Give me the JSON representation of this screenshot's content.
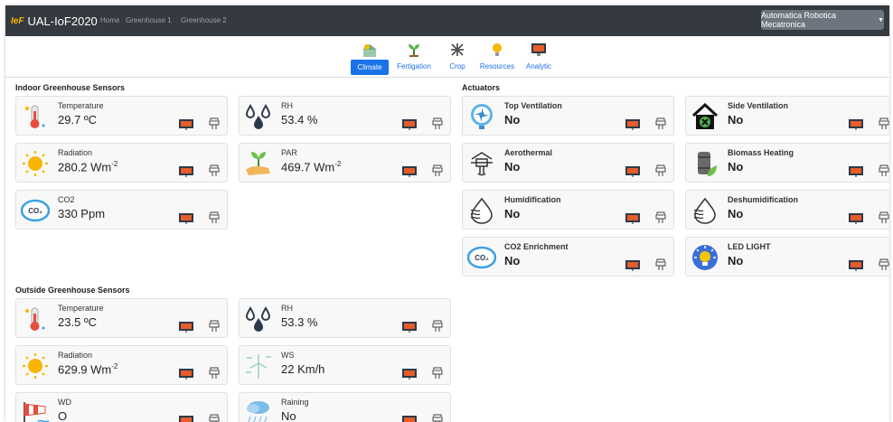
{
  "navbar": {
    "brand_logo": "IeF",
    "brand_name": "UAL-IoF2020",
    "links": [
      "Home",
      "Greenhouse 1",
      "Greenhouse 2"
    ],
    "user_label": "Automatica Robotica Mecatronica",
    "user_caret": "▼"
  },
  "tabs": [
    {
      "label": "Climate",
      "icon": "climate-icon",
      "active": true
    },
    {
      "label": "Fertigation",
      "icon": "fertigation-icon"
    },
    {
      "label": "Crop",
      "icon": "crop-icon"
    },
    {
      "label": "Resources",
      "icon": "resources-icon"
    },
    {
      "label": "Analytic",
      "icon": "analytic-icon"
    }
  ],
  "sections": {
    "indoor": "Indoor Greenhouse Sensors",
    "actuators": "Actuators",
    "outside": "Outside Greenhouse Sensors"
  },
  "indoor_sensors": [
    {
      "name": "Temperature",
      "value": "29.7 ºC",
      "icon": "thermometer-icon"
    },
    {
      "name": "RH",
      "value": "53.4 %",
      "icon": "water-drops-icon"
    },
    {
      "name": "Radiation",
      "value": "280.2 Wm",
      "sup": "-2",
      "icon": "sun-icon"
    },
    {
      "name": "PAR",
      "value": "469.7 Wm",
      "sup": "-2",
      "icon": "plant-hand-icon"
    },
    {
      "name": "CO2",
      "value": "330 Ppm",
      "icon": "co2-cloud-icon"
    }
  ],
  "actuators": [
    {
      "name": "Top Ventilation",
      "value": "No",
      "icon": "fan-icon"
    },
    {
      "name": "Side Ventilation",
      "value": "No",
      "icon": "house-fan-icon"
    },
    {
      "name": "Aerothermal",
      "value": "No",
      "icon": "aerothermal-icon"
    },
    {
      "name": "Biomass Heating",
      "value": "No",
      "icon": "biomass-icon"
    },
    {
      "name": "Humidification",
      "value": "No",
      "icon": "humidification-icon"
    },
    {
      "name": "Deshumidification",
      "value": "No",
      "icon": "deshumidification-icon"
    },
    {
      "name": "CO2 Enrichment",
      "value": "No",
      "icon": "co2-cloud-icon"
    },
    {
      "name": "LED LIGHT",
      "value": "No",
      "icon": "led-bulb-icon"
    }
  ],
  "outside_sensors": [
    {
      "name": "Temperature",
      "value": "23.5 ºC",
      "icon": "thermometer-icon"
    },
    {
      "name": "RH",
      "value": "53.3 %",
      "icon": "water-drops-icon"
    },
    {
      "name": "Radiation",
      "value": "629.9 Wm",
      "sup": "-2",
      "icon": "sun-icon"
    },
    {
      "name": "WS",
      "value": "22 Km/h",
      "icon": "wind-turbine-icon"
    },
    {
      "name": "WD",
      "value": "O",
      "icon": "windsock-icon"
    },
    {
      "name": "Raining",
      "value": "No",
      "icon": "rain-cloud-icon"
    }
  ],
  "colors": {
    "navbar": "#343a40",
    "accent": "#1a73e8",
    "card_bg": "#f8f8f8"
  }
}
